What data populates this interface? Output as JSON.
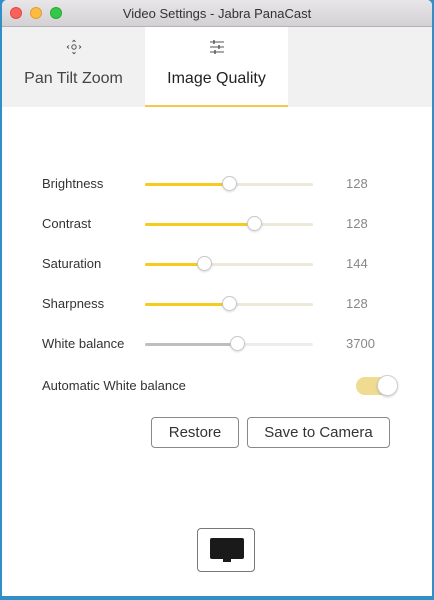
{
  "window": {
    "title": "Video Settings - Jabra PanaCast"
  },
  "tabs": [
    {
      "label": "Pan Tilt Zoom",
      "icon": "pan-tilt-zoom-icon",
      "active": false
    },
    {
      "label": "Image Quality",
      "icon": "sliders-icon",
      "active": true
    }
  ],
  "settings": [
    {
      "label": "Brightness",
      "value": "128",
      "level": 0.5
    },
    {
      "label": "Contrast",
      "value": "128",
      "level": 0.65
    },
    {
      "label": "Saturation",
      "value": "144",
      "level": 0.35
    },
    {
      "label": "Sharpness",
      "value": "128",
      "level": 0.5
    },
    {
      "label": "White balance",
      "value": "3700",
      "level": 0.55,
      "disabled": true
    }
  ],
  "auto_white_balance": {
    "label": "Automatic White balance",
    "on": true
  },
  "buttons": {
    "restore": "Restore",
    "save": "Save to Camera"
  },
  "bottom": {
    "icon": "monitor-icon"
  },
  "colors": {
    "accent": "#f5cc1b",
    "toggle_on": "#f0dc90",
    "desktop_bg": "#2f8fc6"
  }
}
